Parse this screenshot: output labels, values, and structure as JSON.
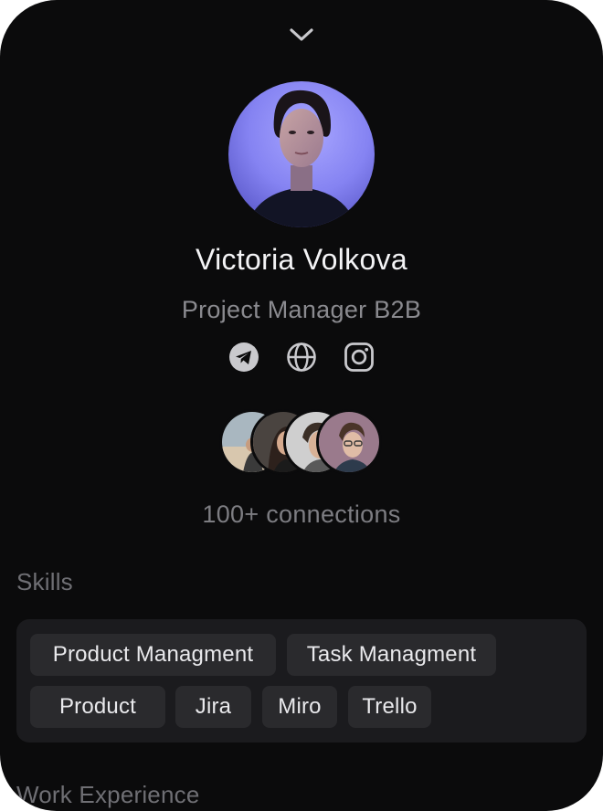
{
  "profile": {
    "name": "Victoria Volkova",
    "role": "Project Manager B2B"
  },
  "social_links": [
    {
      "icon": "telegram-icon"
    },
    {
      "icon": "globe-icon"
    },
    {
      "icon": "instagram-icon"
    }
  ],
  "connections": {
    "label": "100+ connections",
    "avatar_count": 4
  },
  "skills": {
    "title": "Skills",
    "items": [
      "Product Managment",
      "Task Managment",
      "Product",
      "Jira",
      "Miro",
      "Trello"
    ]
  },
  "work_experience": {
    "title": "Work Experience"
  },
  "colors": {
    "background": "#0b0b0c",
    "card": "#1b1b1e",
    "chip": "#2a2a2d",
    "primary_text": "#f4f4f6",
    "secondary_text": "#8a8a8f",
    "avatar_glow": "#8f8cff"
  }
}
